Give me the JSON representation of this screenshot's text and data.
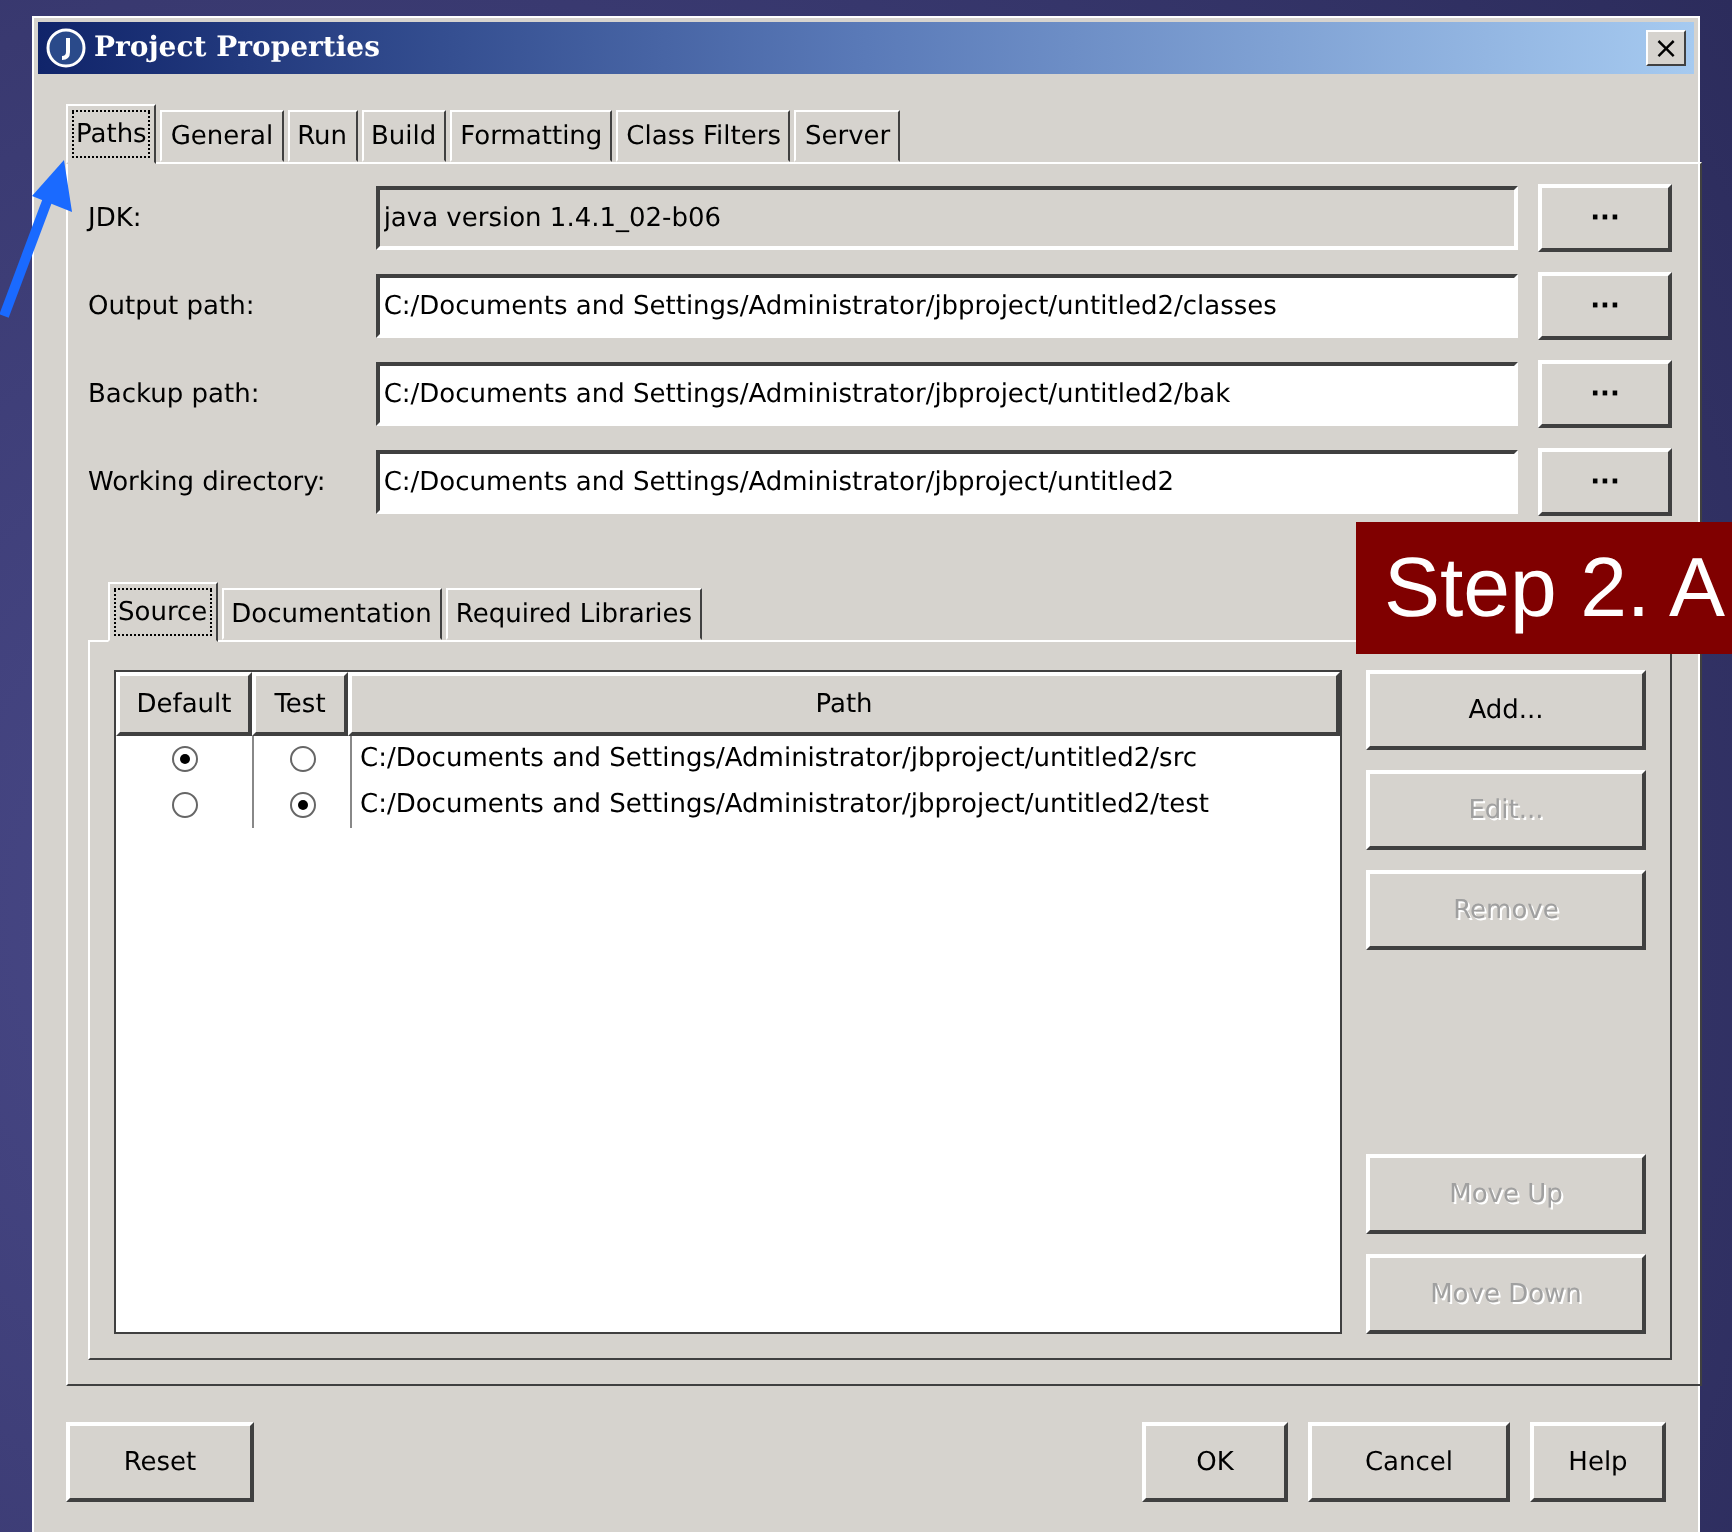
{
  "window": {
    "title": "Project Properties",
    "close": "×"
  },
  "tabs": [
    {
      "label": "Paths",
      "selected": true
    },
    {
      "label": "General",
      "selected": false
    },
    {
      "label": "Run",
      "selected": false
    },
    {
      "label": "Build",
      "selected": false
    },
    {
      "label": "Formatting",
      "selected": false
    },
    {
      "label": "Class Filters",
      "selected": false
    },
    {
      "label": "Server",
      "selected": false
    }
  ],
  "fields": [
    {
      "label": "JDK:",
      "value": "java version 1.4.1_02-b06",
      "disabled": true,
      "button": "···"
    },
    {
      "label": "Output path:",
      "value": "C:/Documents and Settings/Administrator/jbproject/untitled2/classes",
      "disabled": false,
      "button": "···"
    },
    {
      "label": "Backup path:",
      "value": "C:/Documents and Settings/Administrator/jbproject/untitled2/bak",
      "disabled": false,
      "button": "···"
    },
    {
      "label": "Working directory:",
      "value": "C:/Documents and Settings/Administrator/jbproject/untitled2",
      "disabled": false,
      "button": "···"
    }
  ],
  "inner_tabs": [
    {
      "label": "Source",
      "selected": true
    },
    {
      "label": "Documentation",
      "selected": false
    },
    {
      "label": "Required Libraries",
      "selected": false
    }
  ],
  "table": {
    "columns": [
      "Default",
      "Test",
      "Path"
    ],
    "rows": [
      {
        "default": true,
        "test": false,
        "path": "C:/Documents and Settings/Administrator/jbproject/untitled2/src"
      },
      {
        "default": false,
        "test": true,
        "path": "C:/Documents and Settings/Administrator/jbproject/untitled2/test"
      }
    ]
  },
  "side_buttons": [
    {
      "label": "Add...",
      "disabled": false
    },
    {
      "label": "Edit...",
      "disabled": true
    },
    {
      "label": "Remove",
      "disabled": true
    },
    {
      "label": "Move Up",
      "disabled": true
    },
    {
      "label": "Move Down",
      "disabled": true
    }
  ],
  "footer_buttons": {
    "left": [
      "Reset"
    ],
    "right": [
      "OK",
      "Cancel",
      "Help"
    ]
  },
  "banner": "Step 2. A"
}
